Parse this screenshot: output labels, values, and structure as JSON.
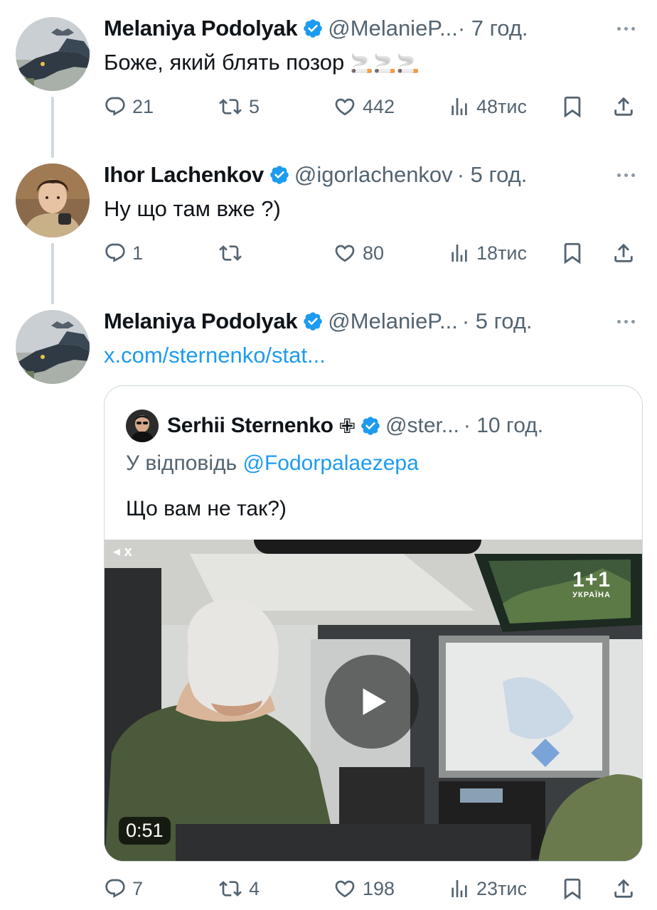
{
  "tweets": [
    {
      "name": "Melaniya Podolyak",
      "handle": "@MelanieP...",
      "time": "· 7 год.",
      "text": "Боже, який блять позор",
      "emoji": "🚬🚬🚬",
      "replies": "21",
      "reposts": "5",
      "likes": "442",
      "views": "48тис"
    },
    {
      "name": "Ihor Lachenkov",
      "handle": "@igorlachenkov",
      "time": "· 5 год.",
      "text": "Ну що там вже ?)",
      "replies": "1",
      "reposts": "",
      "likes": "80",
      "views": "18тис"
    },
    {
      "name": "Melaniya Podolyak",
      "handle": "@MelanieP...",
      "time": "· 5 год.",
      "link": "x.com/sternenko/stat...",
      "replies": "7",
      "reposts": "4",
      "likes": "198",
      "views": "23тис"
    }
  ],
  "quote": {
    "name": "Serhii Sternenko",
    "badge": "✙",
    "handle": "@ster...",
    "time": "· 10 год.",
    "reply_prefix": "У відповідь",
    "reply_to": "@Fodorpalaezepa",
    "text": "Що вам не так?)",
    "video": {
      "duration": "0:51",
      "channel_logo_top": "1+1",
      "channel_logo_bottom": "УКРАЇНА",
      "mute_label": "◂ x"
    }
  },
  "colors": {
    "accent": "#1d9bf0",
    "secondary_text": "#536471",
    "border": "#cfd9de"
  }
}
